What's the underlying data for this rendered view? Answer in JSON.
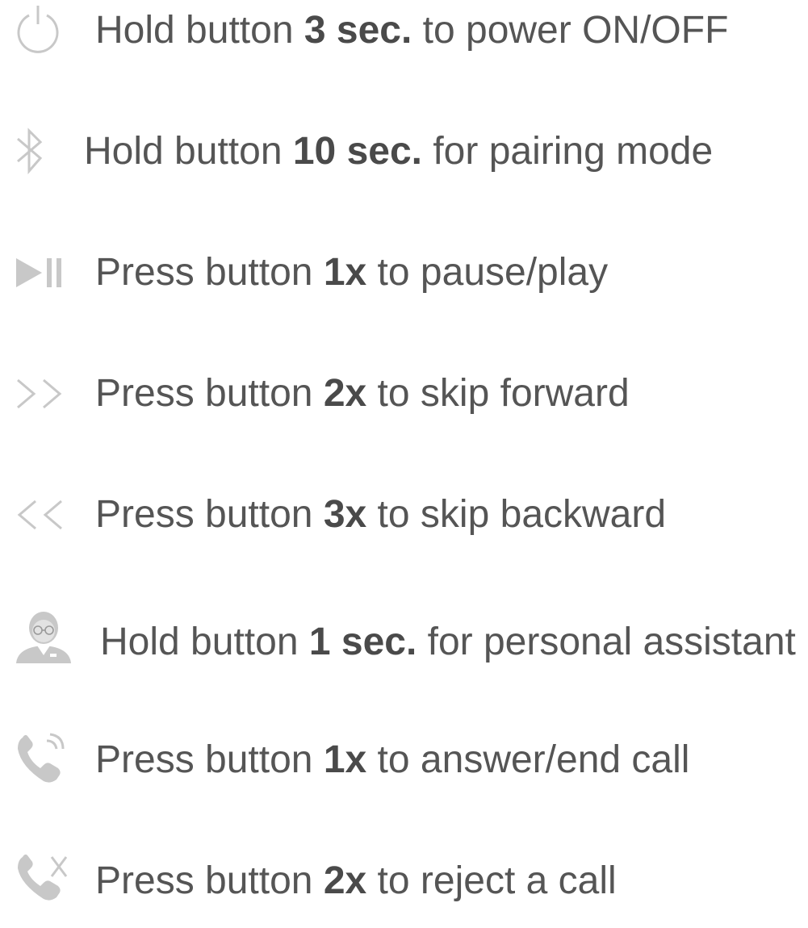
{
  "instructions": [
    {
      "icon": "power-icon",
      "pre": "Hold button ",
      "bold": "3 sec.",
      "post": " to power ON/OFF"
    },
    {
      "icon": "bluetooth-icon",
      "pre": "Hold button ",
      "bold": "10 sec.",
      "post": " for pairing mode"
    },
    {
      "icon": "play-pause-icon",
      "pre": "Press button ",
      "bold": "1x",
      "post": " to pause/play"
    },
    {
      "icon": "skip-forward-icon",
      "pre": "Press button ",
      "bold": "2x",
      "post": " to skip forward"
    },
    {
      "icon": "skip-backward-icon",
      "pre": "Press button ",
      "bold": "3x",
      "post": " to skip backward"
    },
    {
      "icon": "personal-assistant-icon",
      "pre": "Hold button ",
      "bold": "1 sec.",
      "post": " for personal assistant"
    },
    {
      "icon": "phone-answer-icon",
      "pre": "Press button ",
      "bold": "1x",
      "post": " to answer/end call"
    },
    {
      "icon": "phone-reject-icon",
      "pre": "Press button ",
      "bold": "2x",
      "post": " to reject a call"
    }
  ],
  "colors": {
    "icon": "#c8c8c8",
    "text": "#555555"
  }
}
